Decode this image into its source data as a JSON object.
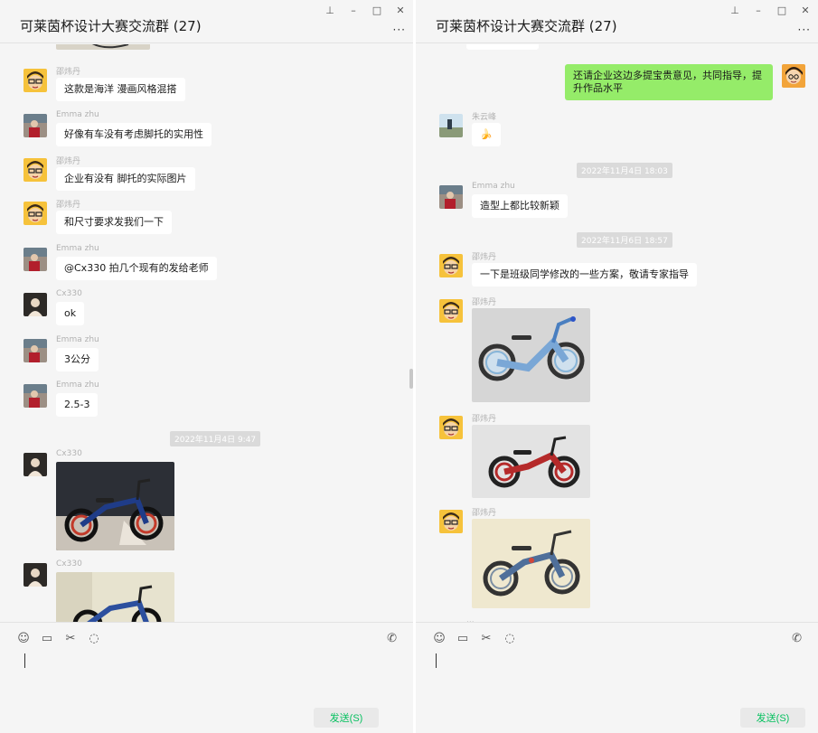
{
  "left": {
    "title": "可莱茵杯设计大赛交流群 (27)",
    "timestamp": "2022年11月4日 9:47",
    "messages": [
      {
        "nick": "邵炜丹",
        "text": "这款是海洋 漫画风格混搭"
      },
      {
        "nick": "Emma zhu",
        "text": "好像有车没有考虑脚托的实用性"
      },
      {
        "nick": "邵炜丹",
        "text": "企业有没有 脚托的实际图片"
      },
      {
        "nick": "邵炜丹",
        "text": "和尺寸要求发我们一下"
      },
      {
        "nick": "Emma zhu",
        "text": "@Cx330 拍几个现有的发给老师"
      },
      {
        "nick": "Cx330",
        "text": "ok"
      },
      {
        "nick": "Emma zhu",
        "text": "3公分"
      },
      {
        "nick": "Emma zhu",
        "text": "2.5-3"
      },
      {
        "nick": "Cx330"
      },
      {
        "nick": "Cx330"
      }
    ],
    "send_label": "发送(S)"
  },
  "right": {
    "title": "可莱茵杯设计大赛交流群 (27)",
    "self_message": "还请企业这边多提宝贵意见，共同指导，提升作品水平",
    "timestamps": [
      "2022年11月4日 18:03",
      "2022年11月6日 18:57"
    ],
    "messages": [
      {
        "nick": "朱云峰",
        "text": "🍌"
      },
      {
        "nick": "Emma zhu",
        "text": "造型上都比较新颖"
      },
      {
        "nick": "邵炜丹",
        "text": "一下是班级同学修改的一些方案，敬请专家指导"
      },
      {
        "nick": "邵炜丹"
      },
      {
        "nick": "邵炜丹"
      },
      {
        "nick": "邵炜丹"
      }
    ],
    "send_label": "发送(S)"
  },
  "icons": [
    "pin-icon",
    "minimize-icon",
    "maximize-icon",
    "close-icon",
    "more-icon",
    "emoji-icon",
    "folder-icon",
    "scissors-icon",
    "chat-bubble-icon",
    "phone-icon"
  ],
  "colors": {
    "self_bubble": "#95ec69",
    "send_text": "#07c160",
    "background": "#f5f5f5"
  }
}
